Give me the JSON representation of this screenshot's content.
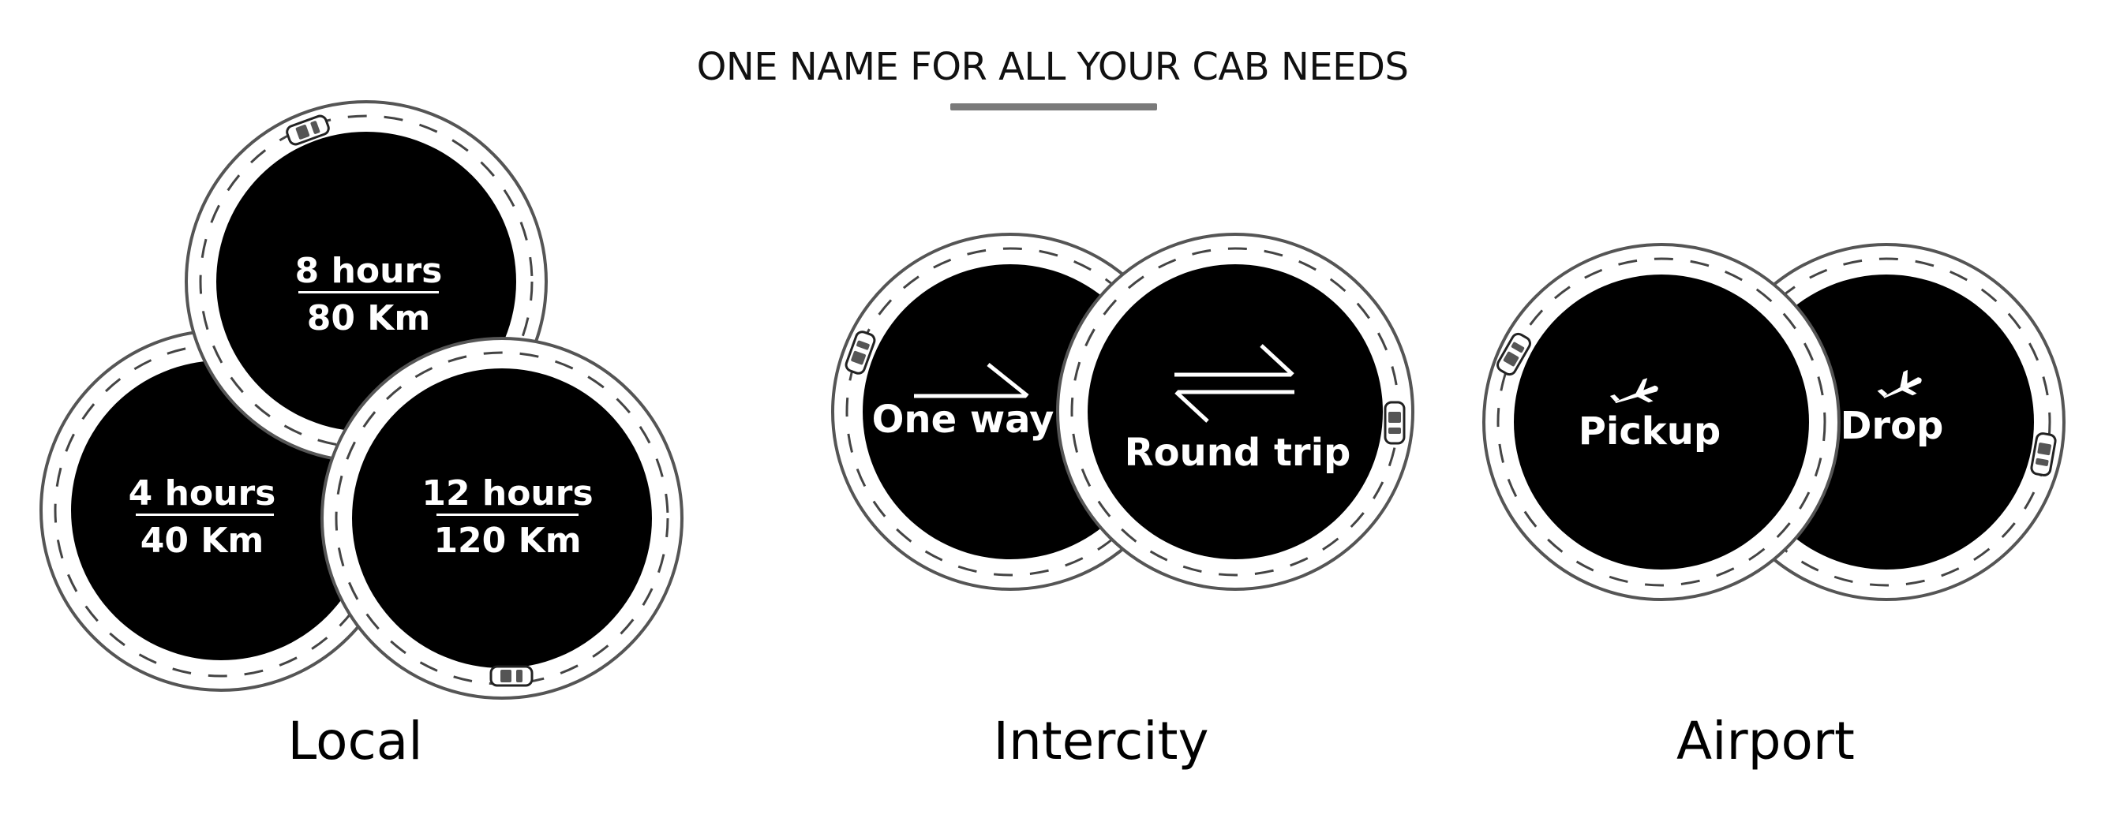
{
  "header": {
    "title": "ONE NAME FOR ALL YOUR CAB NEEDS"
  },
  "local": {
    "label": "Local",
    "packages": [
      {
        "hours": "8 hours",
        "distance": "80 Km"
      },
      {
        "hours": "4 hours",
        "distance": "40 Km"
      },
      {
        "hours": "12 hours",
        "distance": "120 Km"
      }
    ]
  },
  "intercity": {
    "label": "Intercity",
    "options": [
      {
        "label": "One way",
        "icon": "arrow-right-icon"
      },
      {
        "label": "Round trip",
        "icon": "swap-arrows-icon"
      }
    ]
  },
  "airport": {
    "label": "Airport",
    "options": [
      {
        "label": "Pickup",
        "icon": "plane-landing-icon"
      },
      {
        "label": "Drop",
        "icon": "plane-takeoff-icon"
      }
    ]
  },
  "colors": {
    "disc": "#000000",
    "road": "#ffffff",
    "outline": "#555555",
    "underline": "#7a7a7a",
    "text": "#111111"
  }
}
